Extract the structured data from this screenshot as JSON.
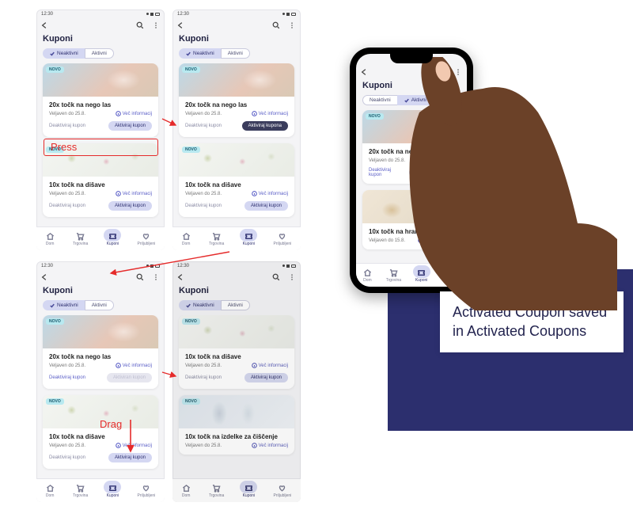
{
  "status_time": "12:30",
  "page_title": "Kuponi",
  "filters": {
    "inactive": "Neaktivni",
    "active": "Aktivni"
  },
  "badge_new": "NOVO",
  "more_info": "Več informacij",
  "nav": {
    "home": "Dom",
    "store": "Trgovina",
    "coupons": "Kuponi",
    "fav": "Priljubljeni"
  },
  "actions": {
    "activate": "Aktiviraj kupon",
    "activate_plural": "Aktiviraj kupona",
    "activated": "Aktiviran kupon",
    "deactivate": "Deaktiviraj kupon",
    "deactivated": "Deaktiviraj kupon"
  },
  "coupons": {
    "hair": {
      "title": "20x točk na nego las",
      "valid": "Veljaven do 25.8."
    },
    "perfume": {
      "title": "10x točk na dišave",
      "valid": "Veljaven do 25.8."
    },
    "dogfood": {
      "title": "10x točk na hrano za pse",
      "valid": "Veljaven do 15.8."
    },
    "cleaning": {
      "title": "10x točk na izdelke za čiščenje",
      "valid": "Veljaven do 25.8."
    }
  },
  "anno": {
    "press": "Press",
    "drag": "Drag"
  },
  "hero_caption": "Activated Coupon saved in Activated Coupons"
}
